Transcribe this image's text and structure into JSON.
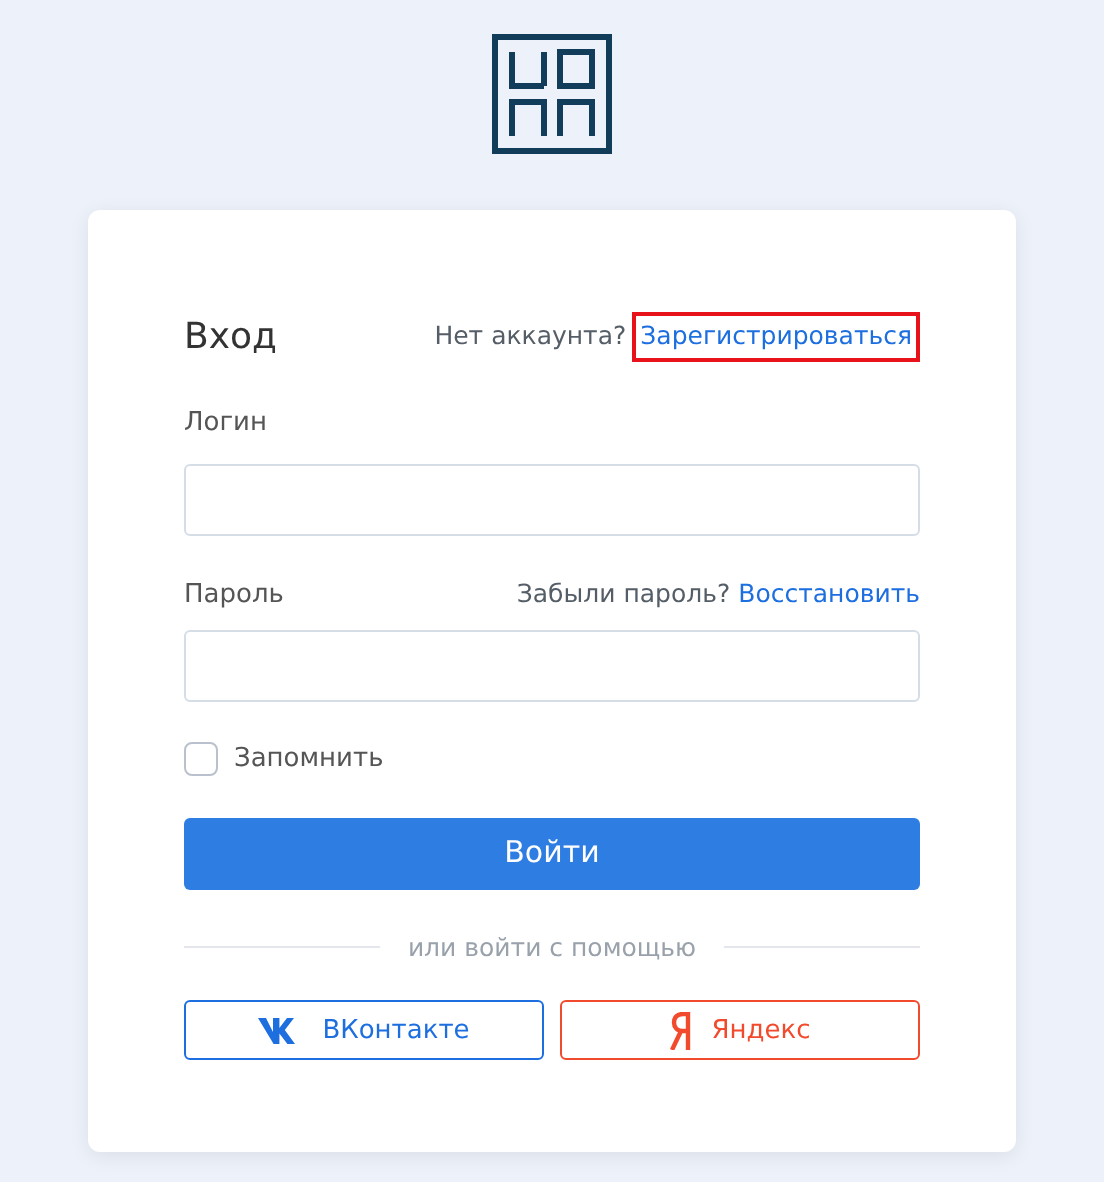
{
  "form": {
    "title": "Вход",
    "no_account": "Нет аккаунта?",
    "register_link": {
      "label": "Зарегистрироваться",
      "highlighted": true
    },
    "login": {
      "label": "Логин"
    },
    "password": {
      "label": "Пароль",
      "forgot": "Забыли пароль?",
      "restore_link": "Восстановить"
    },
    "remember": {
      "label": "Запомнить",
      "checked": false
    },
    "submit": "Войти",
    "divider": "или войти с помощью",
    "social": [
      {
        "kind": "vk",
        "label": "ВКонтакте"
      },
      {
        "kind": "yandex",
        "label": "Яндекс"
      }
    ]
  }
}
